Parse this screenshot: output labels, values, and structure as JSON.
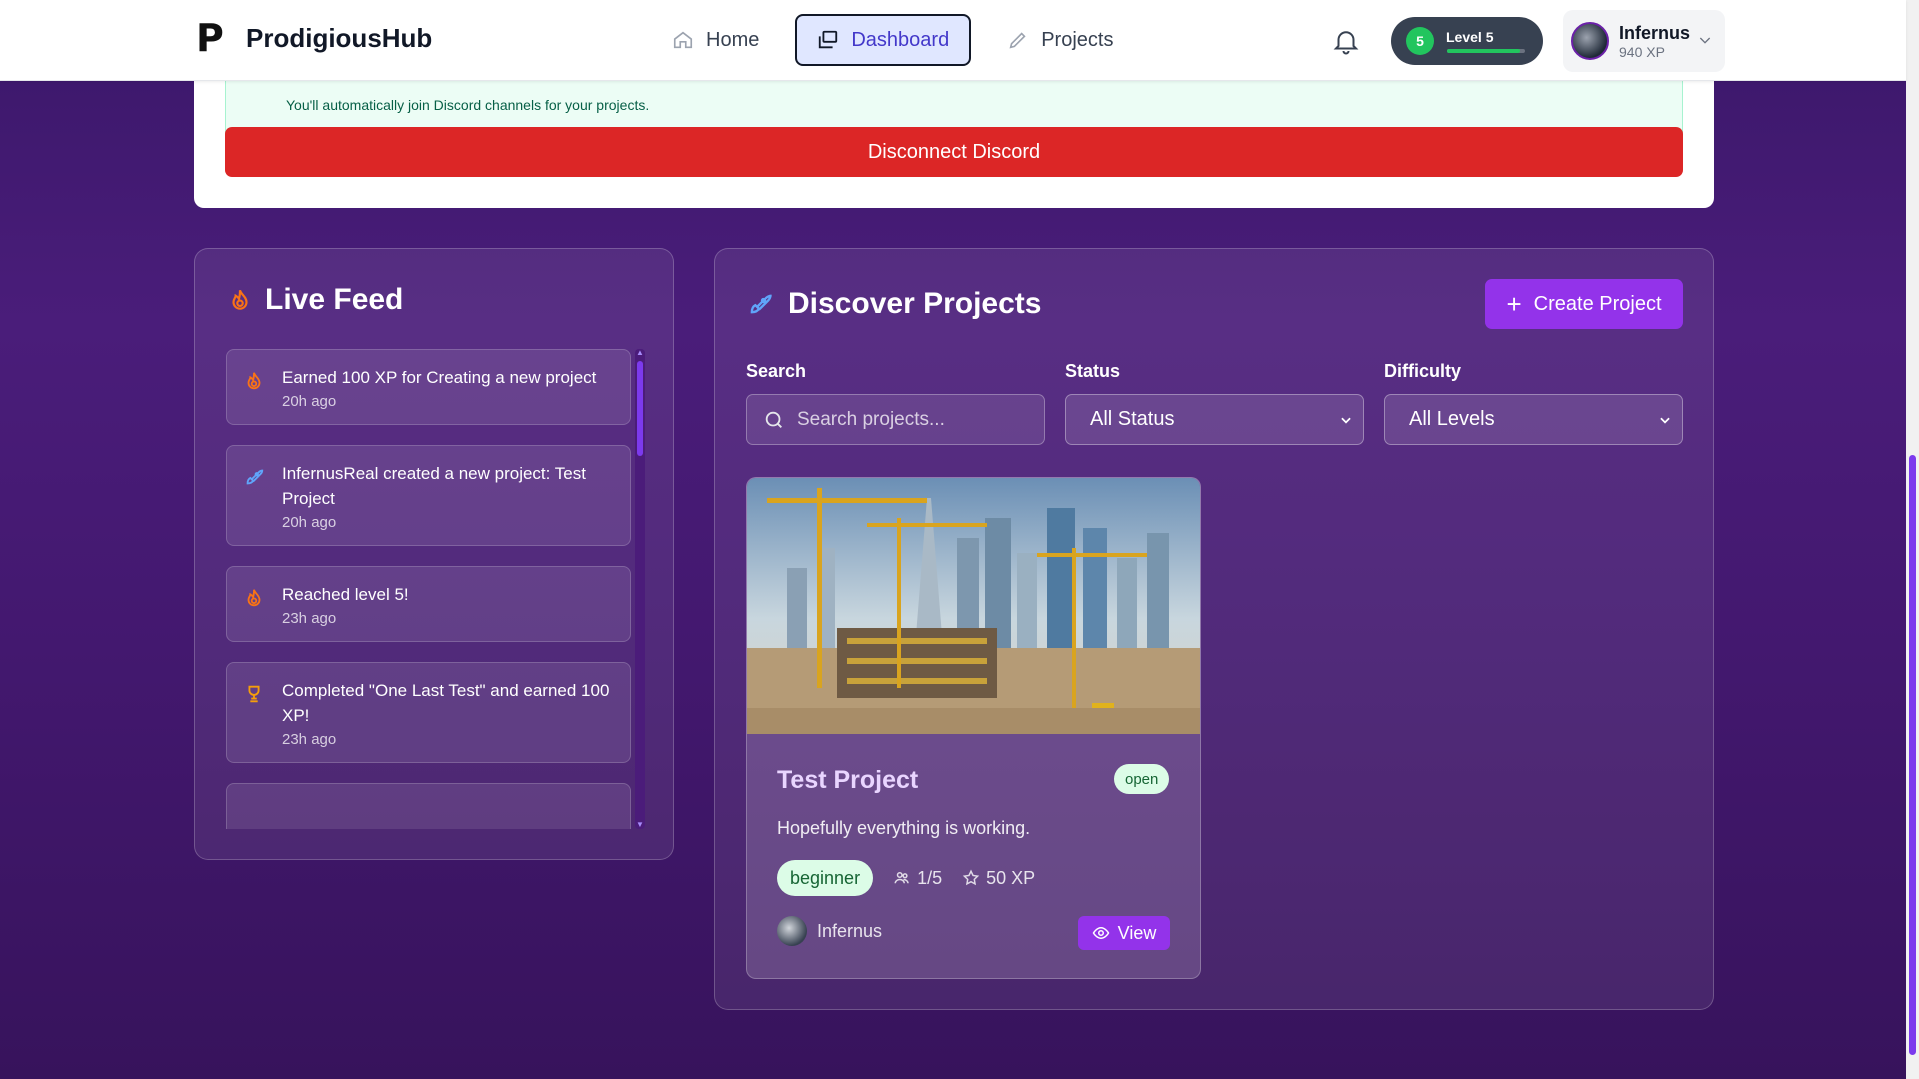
{
  "header": {
    "brand_logo": "P",
    "brand_name": "ProdigiousHub",
    "nav": [
      {
        "label": "Home",
        "icon": "home-icon"
      },
      {
        "label": "Dashboard",
        "icon": "dashboard-icon",
        "active": true
      },
      {
        "label": "Projects",
        "icon": "pencil-icon"
      }
    ],
    "level_number": "5",
    "level_label": "Level 5",
    "level_progress": 0.94,
    "user_name": "Infernus",
    "user_xp": "940 XP"
  },
  "discord": {
    "note": "You'll automatically join Discord channels for your projects.",
    "disconnect_label": "Disconnect Discord"
  },
  "feed": {
    "title": "Live Feed",
    "items": [
      {
        "text": "Earned 100 XP for Creating a new project",
        "time": "20h ago",
        "icon": "flame-icon"
      },
      {
        "text": "InfernusReal created a new project: Test Project",
        "time": "20h ago",
        "icon": "rocket-icon"
      },
      {
        "text": "Reached level 5!",
        "time": "23h ago",
        "icon": "flame-icon"
      },
      {
        "text": "Completed \"One Last Test\" and earned 100 XP!",
        "time": "23h ago",
        "icon": "trophy-icon"
      }
    ]
  },
  "discover": {
    "title": "Discover Projects",
    "create_label": "Create Project",
    "search_label": "Search",
    "search_placeholder": "Search projects...",
    "status_label": "Status",
    "status_value": "All Status",
    "difficulty_label": "Difficulty",
    "difficulty_value": "All Levels",
    "project": {
      "title": "Test Project",
      "status": "open",
      "description": "Hopefully everything is working.",
      "difficulty": "beginner",
      "members": "1/5",
      "xp": "50 XP",
      "owner": "Infernus",
      "view_label": "View"
    }
  },
  "colors": {
    "accent": "#9333ea",
    "danger": "#dc2626",
    "success": "#22c55e"
  }
}
